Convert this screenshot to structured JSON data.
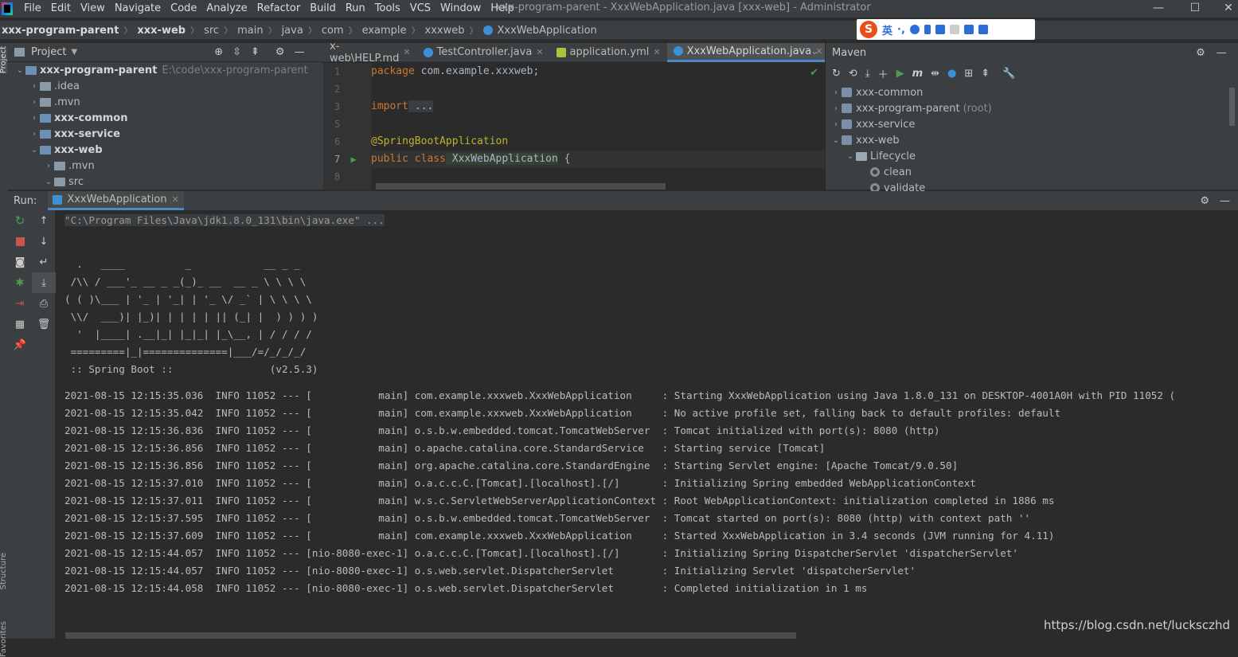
{
  "menubar": {
    "items": [
      "File",
      "Edit",
      "View",
      "Navigate",
      "Code",
      "Analyze",
      "Refactor",
      "Build",
      "Run",
      "Tools",
      "VCS",
      "Window",
      "Help"
    ],
    "title": "xxx-program-parent - XxxWebApplication.java [xxx-web] - Administrator"
  },
  "navbar": {
    "crumbs": [
      "xxx-program-parent",
      "xxx-web",
      "src",
      "main",
      "java",
      "com",
      "example",
      "xxxweb",
      "XxxWebApplication"
    ],
    "run_config": "on"
  },
  "ime": {
    "mode": "英",
    "punct": "·,"
  },
  "project": {
    "header": "Project",
    "tree": [
      {
        "label": "xxx-program-parent",
        "path": "E:\\code\\xxx-program-parent",
        "bold": true,
        "expanded": true
      },
      {
        "label": ".idea"
      },
      {
        "label": ".mvn"
      },
      {
        "label": "xxx-common",
        "bold": true
      },
      {
        "label": "xxx-service",
        "bold": true
      },
      {
        "label": "xxx-web",
        "bold": true,
        "expanded": true
      },
      {
        "label": ".mvn"
      },
      {
        "label": "src",
        "expanded": true
      }
    ]
  },
  "editor": {
    "tabs": [
      {
        "label": "x-web\\HELP.md",
        "active": false
      },
      {
        "label": "TestController.java",
        "active": false
      },
      {
        "label": "application.yml",
        "active": false
      },
      {
        "label": "XxxWebApplication.java",
        "active": true
      }
    ],
    "line_numbers": [
      "1",
      "2",
      "3",
      "5",
      "6",
      "7",
      "8"
    ],
    "lines": {
      "l1_kw": "package",
      "l1_rest": " com.example.xxxweb;",
      "l3_kw": "import",
      "l3_rest": " ...",
      "l6": "@SpringBootApplication",
      "l7_kw": "public class",
      "l7_cls": " XxxWebApplication",
      "l7_rest": " {"
    }
  },
  "maven": {
    "header": "Maven",
    "nodes": [
      {
        "label": "xxx-common"
      },
      {
        "label": "xxx-program-parent",
        "suffix": "(root)"
      },
      {
        "label": "xxx-service"
      },
      {
        "label": "xxx-web",
        "expanded": true
      },
      {
        "label": "Lifecycle",
        "expanded": true
      },
      {
        "label": "clean"
      },
      {
        "label": "validate"
      }
    ]
  },
  "run": {
    "label": "Run:",
    "tab": "XxxWebApplication",
    "command": "\"C:\\Program Files\\Java\\jdk1.8.0_131\\bin\\java.exe\" ...",
    "banner": [
      "  .   ____          _            __ _ _",
      " /\\\\ / ___'_ __ _ _(_)_ __  __ _ \\ \\ \\ \\",
      "( ( )\\___ | '_ | '_| | '_ \\/ _` | \\ \\ \\ \\",
      " \\\\/  ___)| |_)| | | | | || (_| |  ) ) ) )",
      "  '  |____| .__|_| |_|_| |_\\__, | / / / /",
      " =========|_|==============|___/=/_/_/_/",
      " :: Spring Boot ::                (v2.5.3)"
    ],
    "log": [
      "2021-08-15 12:15:35.036  INFO 11052 --- [           main] com.example.xxxweb.XxxWebApplication     : Starting XxxWebApplication using Java 1.8.0_131 on DESKTOP-4001A0H with PID 11052 (",
      "2021-08-15 12:15:35.042  INFO 11052 --- [           main] com.example.xxxweb.XxxWebApplication     : No active profile set, falling back to default profiles: default",
      "2021-08-15 12:15:36.836  INFO 11052 --- [           main] o.s.b.w.embedded.tomcat.TomcatWebServer  : Tomcat initialized with port(s): 8080 (http)",
      "2021-08-15 12:15:36.856  INFO 11052 --- [           main] o.apache.catalina.core.StandardService   : Starting service [Tomcat]",
      "2021-08-15 12:15:36.856  INFO 11052 --- [           main] org.apache.catalina.core.StandardEngine  : Starting Servlet engine: [Apache Tomcat/9.0.50]",
      "2021-08-15 12:15:37.010  INFO 11052 --- [           main] o.a.c.c.C.[Tomcat].[localhost].[/]       : Initializing Spring embedded WebApplicationContext",
      "2021-08-15 12:15:37.011  INFO 11052 --- [           main] w.s.c.ServletWebServerApplicationContext : Root WebApplicationContext: initialization completed in 1886 ms",
      "2021-08-15 12:15:37.595  INFO 11052 --- [           main] o.s.b.w.embedded.tomcat.TomcatWebServer  : Tomcat started on port(s): 8080 (http) with context path ''",
      "2021-08-15 12:15:37.609  INFO 11052 --- [           main] com.example.xxxweb.XxxWebApplication     : Started XxxWebApplication in 3.4 seconds (JVM running for 4.11)",
      "2021-08-15 12:15:44.057  INFO 11052 --- [nio-8080-exec-1] o.a.c.c.C.[Tomcat].[localhost].[/]       : Initializing Spring DispatcherServlet 'dispatcherServlet'",
      "2021-08-15 12:15:44.057  INFO 11052 --- [nio-8080-exec-1] o.s.web.servlet.DispatcherServlet        : Initializing Servlet 'dispatcherServlet'",
      "2021-08-15 12:15:44.058  INFO 11052 --- [nio-8080-exec-1] o.s.web.servlet.DispatcherServlet        : Completed initialization in 1 ms"
    ]
  },
  "side": {
    "project": "Project",
    "structure": "Structure",
    "favorites": "Favorites"
  },
  "watermark": "https://blog.csdn.net/lucksczhd",
  "colors": {
    "accent": "#4a88c7",
    "run_green": "#499c54",
    "stop_red": "#c75450",
    "keyword": "#cc7832",
    "annotation": "#bbb529"
  }
}
